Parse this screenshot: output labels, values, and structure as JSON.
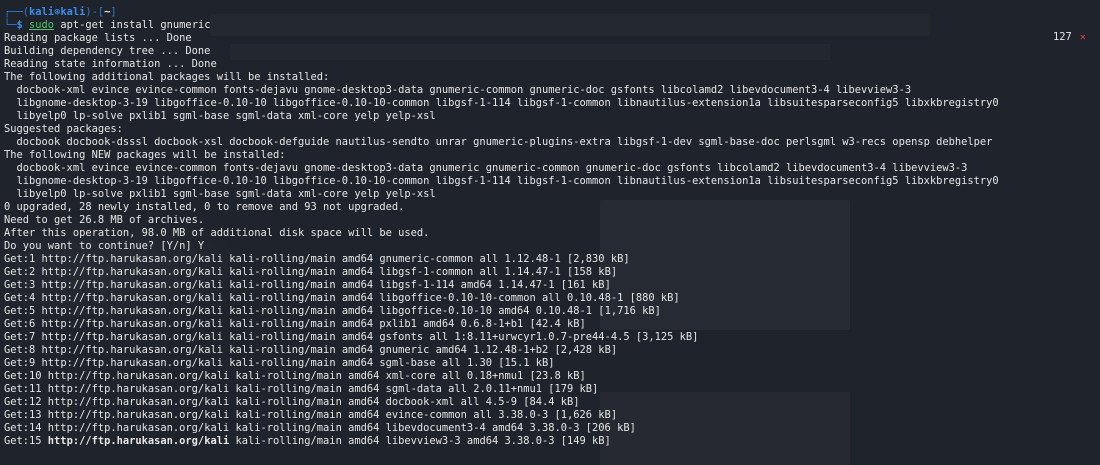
{
  "prompt": {
    "corner": "┌──(",
    "user": "kali",
    "at": "⊛",
    "host": "kali",
    "mid": ")-[",
    "cwd": "~",
    "end": "]",
    "arrow": "└─",
    "dollar": "$ ",
    "sudo": "sudo",
    "command": " apt-get install gnumeric"
  },
  "status": {
    "code": "127",
    "error_icon": "✕"
  },
  "output": [
    "Reading package lists ... Done",
    "Building dependency tree ... Done",
    "Reading state information ... Done",
    "The following additional packages will be installed:",
    "  docbook-xml evince evince-common fonts-dejavu gnome-desktop3-data gnumeric-common gnumeric-doc gsfonts libcolamd2 libevdocument3-4 libevview3-3",
    "  libgnome-desktop-3-19 libgoffice-0.10-10 libgoffice-0.10-10-common libgsf-1-114 libgsf-1-common libnautilus-extension1a libsuitesparseconfig5 libxkbregistry0",
    "  libyelp0 lp-solve pxlib1 sgml-base sgml-data xml-core yelp yelp-xsl",
    "Suggested packages:",
    "  docbook docbook-dsssl docbook-xsl docbook-defguide nautilus-sendto unrar gnumeric-plugins-extra libgsf-1-dev sgml-base-doc perlsgml w3-recs opensp debhelper",
    "The following NEW packages will be installed:",
    "  docbook-xml evince evince-common fonts-dejavu gnome-desktop3-data gnumeric gnumeric-common gnumeric-doc gsfonts libcolamd2 libevdocument3-4 libevview3-3",
    "  libgnome-desktop-3-19 libgoffice-0.10-10 libgoffice-0.10-10-common libgsf-1-114 libgsf-1-common libnautilus-extension1a libsuitesparseconfig5 libxkbregistry0",
    "  libyelp0 lp-solve pxlib1 sgml-base sgml-data xml-core yelp yelp-xsl",
    "0 upgraded, 28 newly installed, 0 to remove and 93 not upgraded.",
    "Need to get 26.8 MB of archives.",
    "After this operation, 98.0 MB of additional disk space will be used.",
    "Do you want to continue? [Y/n] Y"
  ],
  "downloads": [
    {
      "prefix": "Get:1 ",
      "url": "http://ftp.harukasan.org/kali",
      "rest": " kali-rolling/main amd64 gnumeric-common all 1.12.48-1 [2,830 kB]"
    },
    {
      "prefix": "Get:2 ",
      "url": "http://ftp.harukasan.org/kali",
      "rest": " kali-rolling/main amd64 libgsf-1-common all 1.14.47-1 [158 kB]"
    },
    {
      "prefix": "Get:3 ",
      "url": "http://ftp.harukasan.org/kali",
      "rest": " kali-rolling/main amd64 libgsf-1-114 amd64 1.14.47-1 [161 kB]"
    },
    {
      "prefix": "Get:4 ",
      "url": "http://ftp.harukasan.org/kali",
      "rest": " kali-rolling/main amd64 libgoffice-0.10-10-common all 0.10.48-1 [880 kB]"
    },
    {
      "prefix": "Get:5 ",
      "url": "http://ftp.harukasan.org/kali",
      "rest": " kali-rolling/main amd64 libgoffice-0.10-10 amd64 0.10.48-1 [1,716 kB]"
    },
    {
      "prefix": "Get:6 ",
      "url": "http://ftp.harukasan.org/kali",
      "rest": " kali-rolling/main amd64 pxlib1 amd64 0.6.8-1+b1 [42.4 kB]"
    },
    {
      "prefix": "Get:7 ",
      "url": "http://ftp.harukasan.org/kali",
      "rest": " kali-rolling/main amd64 gsfonts all 1:8.11+urwcyr1.0.7-pre44-4.5 [3,125 kB]"
    },
    {
      "prefix": "Get:8 ",
      "url": "http://ftp.harukasan.org/kali",
      "rest": " kali-rolling/main amd64 gnumeric amd64 1.12.48-1+b2 [2,428 kB]"
    },
    {
      "prefix": "Get:9 ",
      "url": "http://ftp.harukasan.org/kali",
      "rest": " kali-rolling/main amd64 sgml-base all 1.30 [15.1 kB]"
    },
    {
      "prefix": "Get:10 ",
      "url": "http://ftp.harukasan.org/kali",
      "rest": " kali-rolling/main amd64 xml-core all 0.18+nmu1 [23.8 kB]"
    },
    {
      "prefix": "Get:11 ",
      "url": "http://ftp.harukasan.org/kali",
      "rest": " kali-rolling/main amd64 sgml-data all 2.0.11+nmu1 [179 kB]"
    },
    {
      "prefix": "Get:12 ",
      "url": "http://ftp.harukasan.org/kali",
      "rest": " kali-rolling/main amd64 docbook-xml all 4.5-9 [84.4 kB]"
    },
    {
      "prefix": "Get:13 ",
      "url": "http://ftp.harukasan.org/kali",
      "rest": " kali-rolling/main amd64 evince-common all 3.38.0-3 [1,626 kB]"
    },
    {
      "prefix": "Get:14 ",
      "url": "http://ftp.harukasan.org/kali",
      "rest": " kali-rolling/main amd64 libevdocument3-4 amd64 3.38.0-3 [206 kB]"
    },
    {
      "prefix": "Get:15 ",
      "url": "http://ftp.harukasan.org/kali",
      "rest": " kali-rolling/main amd64 libevview3-3 amd64 3.38.0-3 [149 kB]"
    }
  ]
}
